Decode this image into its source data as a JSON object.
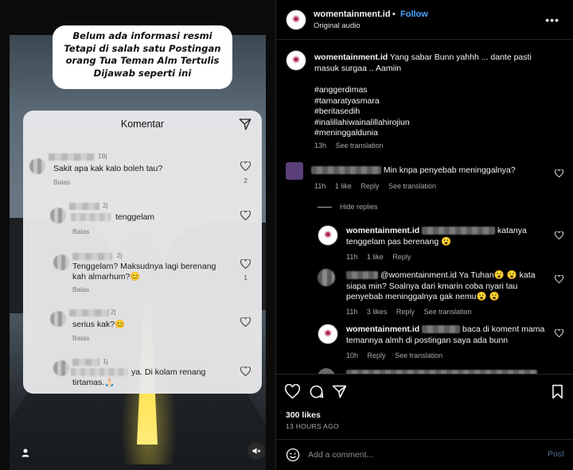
{
  "video": {
    "banner_lines": [
      "Belum ada informasi resmi",
      "Tetapi di salah satu Postingan",
      "orang Tua Teman Alm Tertulis",
      "Dijawab seperti ini"
    ],
    "sheet_title": "Komentar",
    "comments": [
      {
        "time": "18j",
        "text": "Sakit apa kak kalo boleh tau?",
        "reply": "Balas",
        "likes": "2"
      },
      {
        "time": "2j",
        "text": "tenggelam",
        "reply": "Balas",
        "likes": ""
      },
      {
        "time": "2j",
        "text": "Tenggelam? Maksudnya lagi berenang kah almarhum?😊",
        "reply": "Balas",
        "likes": "1"
      },
      {
        "time": "2j",
        "text": "serius kak?😊",
        "reply": "Balas",
        "likes": ""
      },
      {
        "time": "1j",
        "text": "ya. Di kolam renang tirtamas.🙏🏻",
        "reply": "",
        "likes": ""
      }
    ]
  },
  "post": {
    "username": "womentainment.id",
    "dot": "•",
    "follow_label": "Follow",
    "audio_label": "Original audio",
    "caption": {
      "username": "womentainment.id",
      "text": "Yang sabar Bunn yahhh ... dante pasti masuk surgaa .. Aamiin",
      "hashtags": [
        "#anggerdimas",
        "#tamaratyasmara",
        "#beritasedih",
        "#inalillahiwainalillahirojiun",
        "#meninggaldunia"
      ],
      "time": "13h",
      "see_translation": "See translation"
    },
    "comments": [
      {
        "text": "Min knpa penyebab meninggalnya?",
        "time": "11h",
        "likes": "1 like",
        "reply": "Reply",
        "see_translation": "See translation"
      }
    ],
    "hide_replies": "Hide replies",
    "replies": [
      {
        "username": "womentainment.id",
        "text": "katanya tenggelam pas berenang 😮",
        "time": "11h",
        "likes": "1 like",
        "reply": "Reply",
        "see_translation": ""
      },
      {
        "mention": "@womentainment.id",
        "text": "Ya Tuhan😮 😮 kata siapa min? Soalnya dari kmarin coba nyari tau penyebab meninggalnya gak nemu😮 😮",
        "time": "11h",
        "likes": "3 likes",
        "reply": "Reply",
        "see_translation": "See translation"
      },
      {
        "username": "womentainment.id",
        "text": "baca di koment mama temannya almh di postingan saya ada bunn",
        "time": "10h",
        "likes": "",
        "reply": "Reply",
        "see_translation": "See translation"
      }
    ],
    "likes_count": "300 likes",
    "posted_ago": "13 HOURS AGO",
    "comment_input": {
      "placeholder": "Add a comment...",
      "value": ""
    },
    "post_button": "Post"
  }
}
